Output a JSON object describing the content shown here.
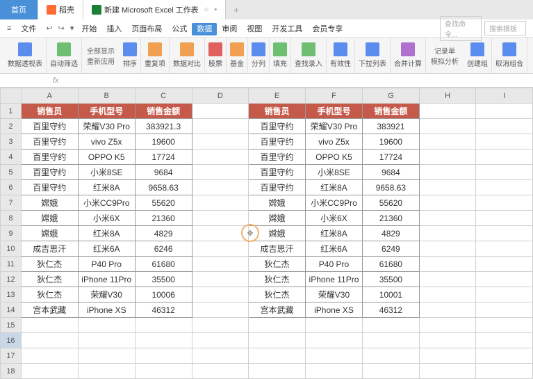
{
  "tabs": {
    "home": "首页",
    "shell": "稻壳",
    "doc": "新建 Microsoft Excel 工作表"
  },
  "menu": {
    "file": "文件",
    "items": [
      "开始",
      "插入",
      "页面布局",
      "公式",
      "数据",
      "审阅",
      "视图",
      "开发工具",
      "会员专享"
    ],
    "active_index": 4,
    "search_ph": "查找命令...",
    "search2_ph": "搜索模板"
  },
  "toolbar": {
    "pivot": "数据透视表",
    "autofilter": "自动筛选",
    "showall": "全部显示",
    "reapply": "重新应用",
    "sort": "排序",
    "dedup": "重复项",
    "datacmp": "数据对比",
    "stock": "股票",
    "fund": "基金",
    "split": "分列",
    "fill": "填充",
    "findrec": "查找录入",
    "validity": "有效性",
    "dropdown": "下拉列表",
    "consol": "合并计算",
    "recform": "记录单",
    "sim": "模拟分析",
    "group": "创建组",
    "ungroup": "取消组合"
  },
  "headers": {
    "a": "销售员",
    "b": "手机型号",
    "c": "销售金额"
  },
  "left": [
    {
      "a": "百里守约",
      "b": "荣耀V30 Pro",
      "c": "383921.3"
    },
    {
      "a": "百里守约",
      "b": "vivo Z5x",
      "c": "19600"
    },
    {
      "a": "百里守约",
      "b": "OPPO K5",
      "c": "17724"
    },
    {
      "a": "百里守约",
      "b": "小米8SE",
      "c": "9684"
    },
    {
      "a": "百里守约",
      "b": "红米8A",
      "c": "9658.63"
    },
    {
      "a": "嫦娥",
      "b": "小米CC9Pro",
      "c": "55620"
    },
    {
      "a": "嫦娥",
      "b": "小米6X",
      "c": "21360"
    },
    {
      "a": "嫦娥",
      "b": "红米8A",
      "c": "4829"
    },
    {
      "a": "成吉思汗",
      "b": "红米6A",
      "c": "6246"
    },
    {
      "a": "狄仁杰",
      "b": "P40 Pro",
      "c": "61680"
    },
    {
      "a": "狄仁杰",
      "b": "iPhone 11Pro",
      "c": "35500"
    },
    {
      "a": "狄仁杰",
      "b": "荣耀V30",
      "c": "10006"
    },
    {
      "a": "宫本武藏",
      "b": "iPhone XS",
      "c": "46312"
    }
  ],
  "right": [
    {
      "a": "百里守约",
      "b": "荣耀V30 Pro",
      "c": "383921"
    },
    {
      "a": "百里守约",
      "b": "vivo Z5x",
      "c": "19600"
    },
    {
      "a": "百里守约",
      "b": "OPPO K5",
      "c": "17724"
    },
    {
      "a": "百里守约",
      "b": "小米8SE",
      "c": "9684"
    },
    {
      "a": "百里守约",
      "b": "红米8A",
      "c": "9658.63"
    },
    {
      "a": "嫦娥",
      "b": "小米CC9Pro",
      "c": "55620"
    },
    {
      "a": "嫦娥",
      "b": "小米6X",
      "c": "21360"
    },
    {
      "a": "嫦娥",
      "b": "红米8A",
      "c": "4829"
    },
    {
      "a": "成吉思汗",
      "b": "红米6A",
      "c": "6249"
    },
    {
      "a": "狄仁杰",
      "b": "P40 Pro",
      "c": "61680"
    },
    {
      "a": "狄仁杰",
      "b": "iPhone 11Pro",
      "c": "35500"
    },
    {
      "a": "狄仁杰",
      "b": "荣耀V30",
      "c": "10001"
    },
    {
      "a": "宫本武藏",
      "b": "iPhone XS",
      "c": "46312"
    }
  ],
  "cols": [
    "A",
    "B",
    "C",
    "D",
    "E",
    "F",
    "G",
    "H",
    "I"
  ],
  "selected_row": 16
}
